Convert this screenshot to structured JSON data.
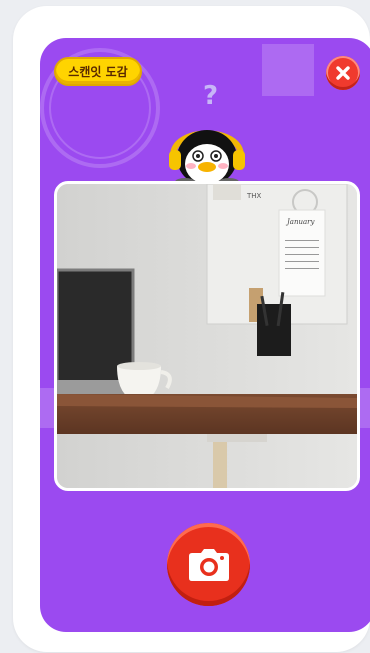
{
  "header": {
    "dex_button_label": "스캔잇 도감",
    "close_icon": "close-icon"
  },
  "hint": {
    "question_mark": "?"
  },
  "mascot": {
    "icon": "penguin-mascot-with-headphones"
  },
  "photo": {
    "description_icon": "desk-scene-photo",
    "note_text": "THX",
    "calendar_title": "January"
  },
  "capture": {
    "icon": "camera-icon"
  },
  "colors": {
    "screen_bg": "#9b4af0",
    "dex_button": "#ffd400",
    "close_button": "#f03a2e",
    "capture_button": "#e8301d"
  }
}
